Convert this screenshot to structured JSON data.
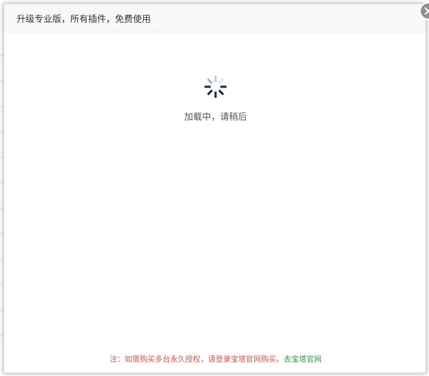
{
  "dialog": {
    "title": "升级专业版，所有插件，免费使用",
    "close_icon": "close-icon"
  },
  "loading": {
    "icon": "spinner-icon",
    "text": "加载中，请稍后"
  },
  "footer": {
    "note": "注：如需购买多台永久授权，请登录宝塔官网购买。",
    "link_label": "去宝塔官网",
    "note_color": "#d9534f",
    "link_color": "#20a53a"
  }
}
